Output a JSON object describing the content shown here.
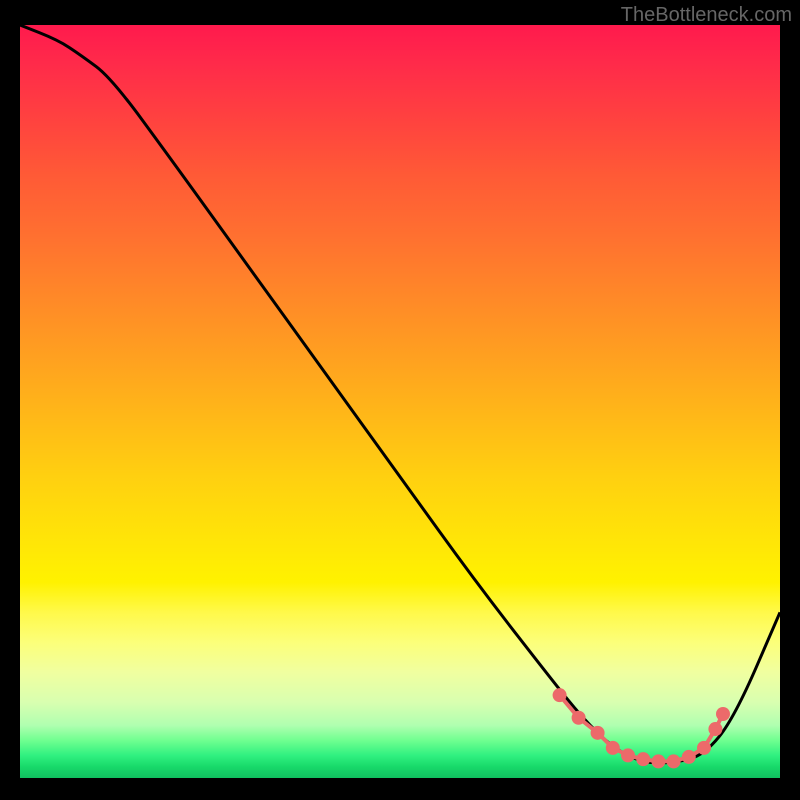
{
  "watermark": "TheBottleneck.com",
  "chart_data": {
    "type": "line",
    "title": "",
    "xlabel": "",
    "ylabel": "",
    "ylim": [
      0,
      100
    ],
    "xlim": [
      0,
      100
    ],
    "series": [
      {
        "name": "curve",
        "x": [
          0,
          5,
          8,
          12,
          20,
          30,
          40,
          50,
          60,
          70,
          74,
          78,
          82,
          86,
          90,
          94,
          100
        ],
        "y": [
          100,
          98,
          96,
          93,
          82,
          68,
          54,
          40,
          26,
          13,
          8,
          4,
          2,
          2,
          3,
          8,
          22
        ]
      },
      {
        "name": "dots",
        "x": [
          71,
          73.5,
          76,
          78,
          80,
          82,
          84,
          86,
          88,
          90,
          91.5,
          92.5
        ],
        "y": [
          11,
          8,
          6,
          4,
          3,
          2.5,
          2.2,
          2.2,
          2.8,
          4,
          6.5,
          8.5
        ]
      }
    ]
  }
}
